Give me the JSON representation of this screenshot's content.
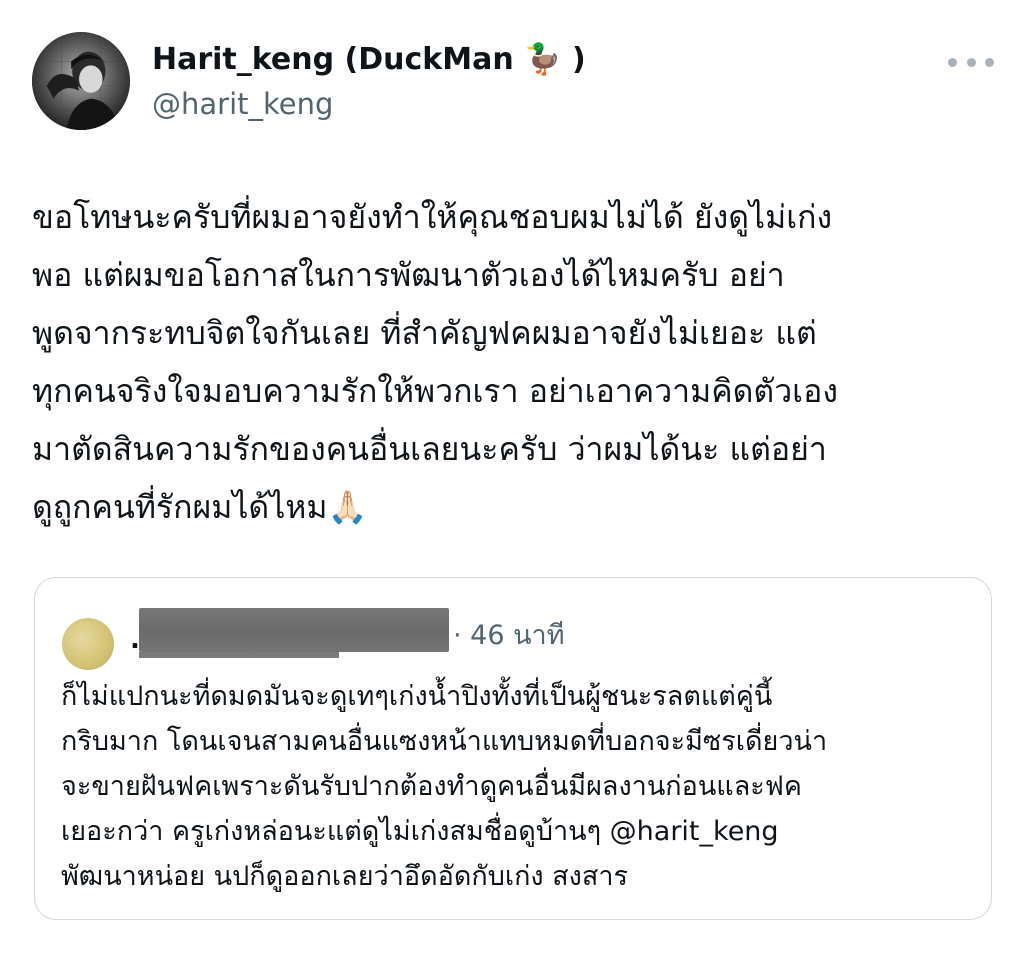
{
  "author": {
    "display_name": "Harit_keng (DuckMan",
    "name_emoji": "🦆",
    "name_close": " )",
    "handle": "@harit_keng"
  },
  "tweet": {
    "text": "ขอโทษนะครับที่ผมอาจยังทำให้คุณชอบผมไม่ได้ ยังดูไม่เก่ง\nพอ แต่ผมขอโอกาสในการพัฒนาตัวเองได้ไหมครับ อย่า\nพูดจากระทบจิตใจกันเลย ที่สำคัญฟคผมอาจยังไม่เยอะ แต่\nทุกคนจริงใจมอบความรักให้พวกเรา อย่าเอาความคิดตัวเอง\nมาตัดสินความรักของคนอื่นเลยนะครับ ว่าผมได้นะ แต่อย่า\nดูถูกคนที่รักผมได้ไหม",
    "emoji": "🙏🏻"
  },
  "quote": {
    "name_prefix": ".",
    "time": "· 46 นาที",
    "text_part1": "ก็ไม่แปกนะที่ดมดมันจะดูเทๆเก่งน้ำปิงทั้งที่เป็นผู้ชนะรลตแต่คู่นี้\nกริบมาก โดนเจนสามคนอื่นแซงหน้าแทบหมดที่บอกจะมีซรเดี่ยวน่า\nจะขายฝันฟคเพราะดันรับปากต้องทำดูคนอื่นมีผลงานก่อนและฟค\nเยอะกว่า ครูเก่งหล่อนะแต่ดูไม่เก่งสมชื่อดูบ้านๆ ",
    "mention": "@harit_keng",
    "text_part2": "\nพัฒนาหน่อย นปก็ดูออกเลยว่าอึดอัดกับเก่ง สงสาร"
  },
  "icons": {
    "more": "more-horizontal-icon",
    "avatar": "user-avatar"
  },
  "colors": {
    "text": "#0f1419",
    "secondary": "#536471",
    "border": "#cfd9de"
  }
}
